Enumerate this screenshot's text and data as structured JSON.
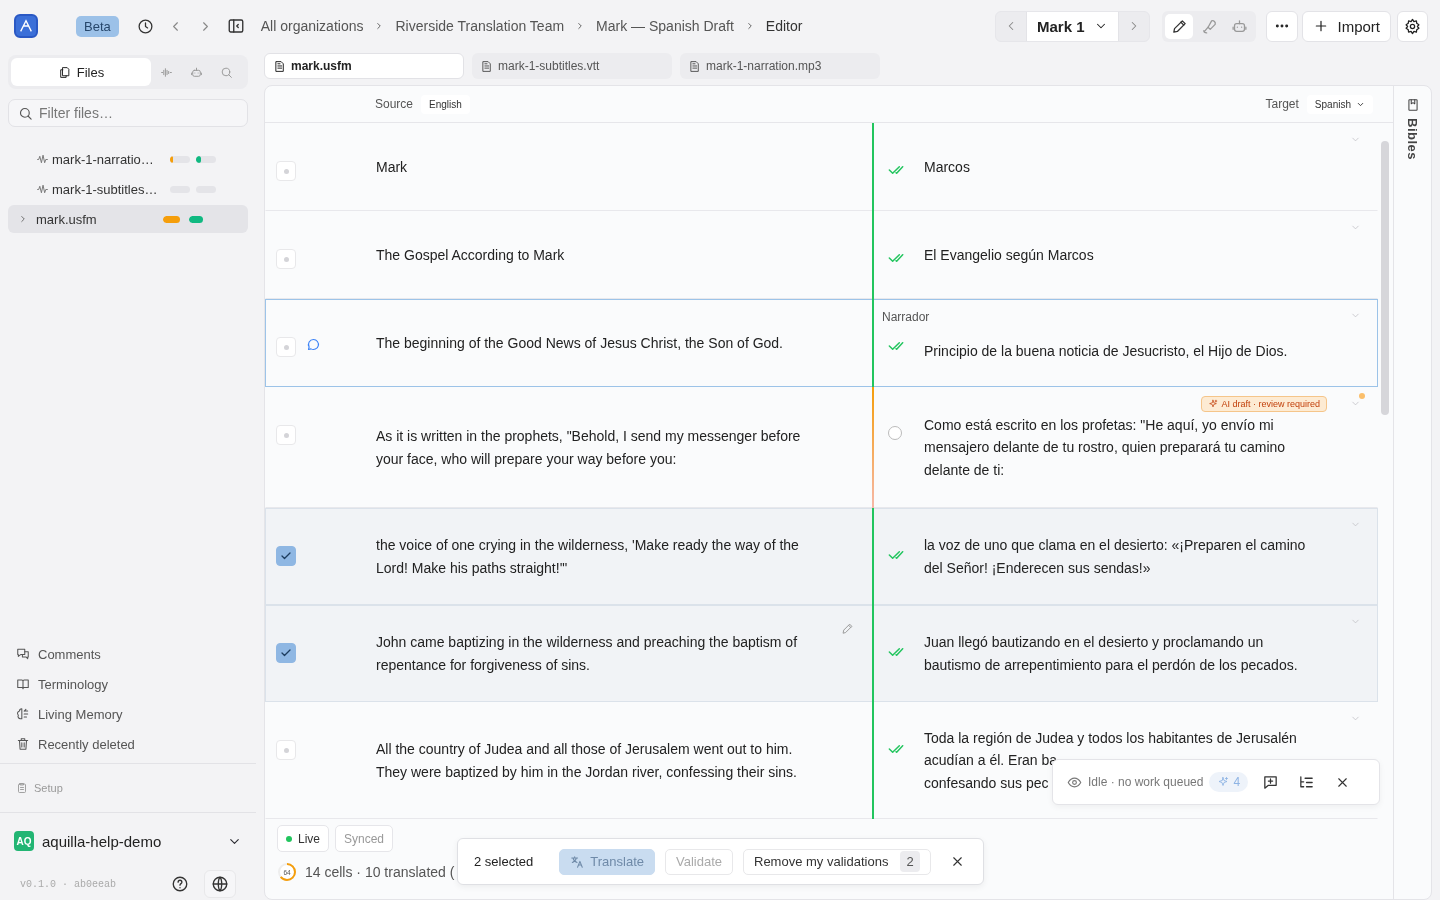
{
  "app": {
    "badge": "Beta"
  },
  "breadcrumbs": [
    "All organizations",
    "Riverside Translation Team",
    "Mark — Spanish Draft",
    "Editor"
  ],
  "chapter_nav": {
    "label": "Mark 1"
  },
  "mode_tools": [
    {
      "kind": "pencil",
      "selected": true
    },
    {
      "kind": "mic",
      "selected": false
    },
    {
      "kind": "robot",
      "selected": false
    }
  ],
  "actions": {
    "import": "Import"
  },
  "sidebar": {
    "tabs": [
      {
        "kind": "files",
        "label": "Files",
        "selected": true
      },
      {
        "kind": "wave",
        "selected": false
      },
      {
        "kind": "robot",
        "selected": false
      },
      {
        "kind": "search",
        "selected": false
      }
    ],
    "filter": {
      "placeholder": "Filter files…"
    },
    "files": [
      {
        "kind": "audio",
        "name": "mark-1-narratio…",
        "drafted": {
          "level": 0.17
        },
        "validated": {
          "level": 0.25
        },
        "selected": false
      },
      {
        "kind": "audio",
        "name": "mark-1-subtitles…",
        "drafted": {
          "level": 0
        },
        "validated": {
          "level": 0
        },
        "selected": false
      },
      {
        "kind": "folder",
        "name": "mark.usfm",
        "drafted": {
          "level": 0.85
        },
        "validated": {
          "level": 0.7
        },
        "selected": true,
        "expanded": false
      }
    ],
    "nav": [
      {
        "kind": "comments",
        "label": "Comments"
      },
      {
        "kind": "book",
        "label": "Terminology"
      },
      {
        "kind": "brain",
        "label": "Living Memory"
      },
      {
        "kind": "trash",
        "label": "Recently deleted"
      }
    ],
    "setup": {
      "label": "Setup",
      "disabled": true
    },
    "workspace": {
      "initials": "AQ",
      "name": "aquilla-help-demo"
    },
    "version": "v0.1.0 · ab0eeab"
  },
  "file_tabs": [
    {
      "label": "mark.usfm",
      "selected": true
    },
    {
      "label": "mark-1-subtitles.vtt",
      "selected": false
    },
    {
      "label": "mark-1-narration.mp3",
      "selected": false
    }
  ],
  "editor": {
    "source_label": "Source",
    "source_lang": "English",
    "target_label": "Target",
    "target_lang": "Spanish",
    "rows": [
      {
        "selected": false,
        "focused": false,
        "validated": true,
        "source": "Mark",
        "target": [
          "Marcos"
        ]
      },
      {
        "selected": false,
        "focused": false,
        "validated": true,
        "source": "The Gospel According to Mark",
        "target": [
          "El Evangelio según Marcos"
        ]
      },
      {
        "selected": false,
        "focused": true,
        "validated": true,
        "has_comment": true,
        "speaker": "Narrador",
        "source": "The beginning of the Good News of Jesus Christ, the Son of God.",
        "target": [
          "Principio de la buena noticia de Jesucristo, el Hijo de Dios."
        ]
      },
      {
        "selected": false,
        "focused": false,
        "validated": false,
        "badge": "AI draft · review required",
        "source": "As it is written in the prophets, \"Behold, I send my messenger before your face, who will prepare your way before you:",
        "target": [
          "Como está escrito en los profetas: \"He aquí, yo envío mi mensajero delante de tu rostro, quien preparará tu camino delante de ti:"
        ]
      },
      {
        "selected": true,
        "focused": false,
        "validated": true,
        "source": "the voice of one crying in the wilderness, 'Make ready the way of the Lord! Make his paths straight!'\"",
        "target": [
          "la voz de uno que clama en el desierto: «¡Preparen el camino del Señor! ¡Enderecen sus sendas!»"
        ]
      },
      {
        "selected": true,
        "focused": false,
        "validated": true,
        "hovered": true,
        "source": "John came baptizing in the wilderness and preaching the baptism of repentance for forgiveness of sins.",
        "target": [
          "Juan llegó bautizando en el desierto y proclamando un bautismo de arrepentimiento para el perdón de los pecados."
        ]
      },
      {
        "selected": false,
        "focused": false,
        "validated": true,
        "source": "All the country of Judea and all those of Jerusalem went out to him. They were baptized by him in the Jordan river, confessing their sins.",
        "target": [
          "Toda la región de Judea y todos los habitantes de Jerusalén",
          "acudían a él. Eran ba",
          "confesando sus pec"
        ]
      }
    ]
  },
  "footer": {
    "connection": {
      "label": "Live",
      "on": true
    },
    "sync": "Synced",
    "progress": {
      "value": "64"
    },
    "summary": "14 cells · 10 translated ("
  },
  "selection_bar": {
    "count": "2 selected",
    "translate": {
      "label": "Translate",
      "disabled": false
    },
    "validate": {
      "label": "Validate",
      "disabled": true
    },
    "remove": {
      "label": "Remove my validations",
      "count": "2"
    }
  },
  "agent_panel": {
    "status": "Idle · no work queued",
    "count": "4"
  },
  "rail": {
    "label": "Bibles"
  }
}
